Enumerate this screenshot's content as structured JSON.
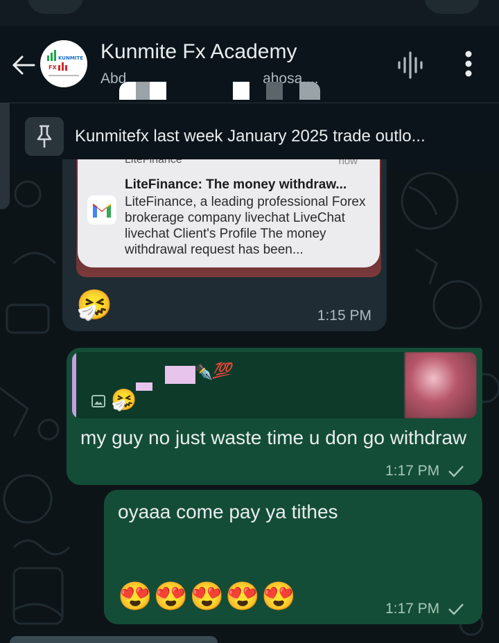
{
  "header": {
    "title": "Kunmite Fx Academy",
    "subtitle_left": "Abd",
    "subtitle_right": "ahosa,...",
    "avatar_text": "KUNMITE FX"
  },
  "pinned": {
    "text": "Kunmitefx last week January 2025 trade outlo..."
  },
  "incoming": {
    "notification": {
      "app_cut": "LiteFinance",
      "time_cut": "now",
      "title": "LiteFinance: The money withdraw...",
      "body": "LiteFinance, a leading professional Forex brokerage company livechat LiveChat livechat Client's Profile The money withdrawal request has been..."
    },
    "emoji": "🤧",
    "time": "1:15 PM"
  },
  "outgoing": [
    {
      "quote_emoji": "🤧",
      "quote_extra_emoji": "💯",
      "quote_pen": "✒️",
      "text": "my guy no just waste time u don go withdraw",
      "time": "1:17 PM"
    },
    {
      "text": "oyaaa come pay ya tithes",
      "emojis": "😍😍😍😍😍",
      "time": "1:17 PM"
    }
  ],
  "colors": {
    "header_bg": "#0b141a",
    "incoming_bubble": "#202c33",
    "outgoing_bubble": "#144d37",
    "quote_bar": "#c79ee0"
  }
}
